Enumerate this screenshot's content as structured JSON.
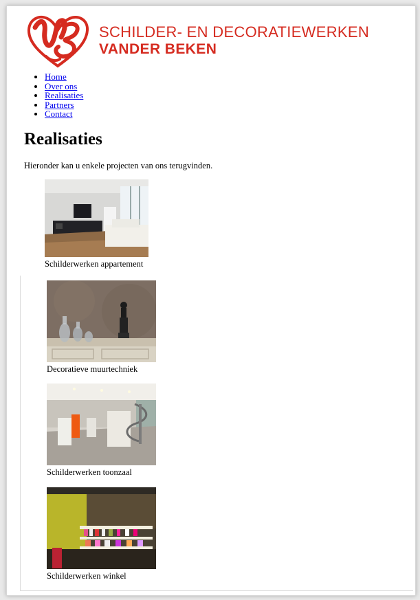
{
  "brand": {
    "line1": "SCHILDER- EN DECORATIEWERKEN",
    "line2": "VANDER BEKEN",
    "color": "#d52b20"
  },
  "nav": {
    "items": [
      {
        "label": "Home"
      },
      {
        "label": "Over ons"
      },
      {
        "label": "Realisaties"
      },
      {
        "label": "Partners"
      },
      {
        "label": "Contact"
      }
    ],
    "link_color": "#0000ee"
  },
  "main": {
    "title": "Realisaties",
    "intro": "Hieronder kan u enkele projecten van ons terugvinden."
  },
  "projects": [
    {
      "caption": "Schilderwerken appartement",
      "image": "living-room-photo"
    },
    {
      "caption": "Decoratieve muurtechniek",
      "image": "decorative-wall-photo"
    },
    {
      "caption": "Schilderwerken toonzaal",
      "image": "showroom-photo"
    },
    {
      "caption": "Schilderwerken winkel",
      "image": "shop-photo"
    }
  ]
}
